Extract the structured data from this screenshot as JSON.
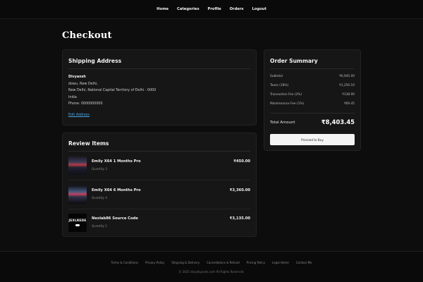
{
  "nav": {
    "items": [
      "Home",
      "Categories",
      "Profile",
      "Orders",
      "Logout"
    ]
  },
  "page": {
    "title": "Checkout"
  },
  "shipping": {
    "title": "Shipping Address",
    "name": "Divyansh",
    "line1": "dowu, New Delhi,",
    "line2": "New Delhi, National Capital Territory of Delhi - 0000",
    "country": "India",
    "phone": "Phone: 0000000000",
    "edit_label": "Edit Address"
  },
  "review": {
    "title": "Review Items",
    "items": [
      {
        "name": "Emily X64 1 Months Pro",
        "qty": "Quantity 3",
        "price": "₹450.00",
        "thumb": "product-image"
      },
      {
        "name": "Emily X64 6 Months Pro",
        "qty": "Quantity 4",
        "price": "₹3,360.00",
        "thumb": "product-image"
      },
      {
        "name": "Nexlab86 Source Code",
        "qty": "Quantity 1",
        "price": "₹3,135.00",
        "thumb": "product-logo",
        "logo_text": "JEXLREDE"
      }
    ]
  },
  "summary": {
    "title": "Order Summary",
    "rows": [
      {
        "label": "Subtotal",
        "value": "₹6,945.00"
      },
      {
        "label": "Taxes (18%)",
        "value": "₹1,250.10"
      },
      {
        "label": "Transaction Fee (2%)",
        "value": "₹138.90"
      },
      {
        "label": "Maintenance Fee (1%)",
        "value": "₹69.45"
      }
    ],
    "total_label": "Total Amount",
    "total_value": "₹8,403.45",
    "buy_label": "Proceed to Buy"
  },
  "footer": {
    "links": [
      "Terms & Conditions",
      "Privacy Policy",
      "Shipping & Delivery",
      "Cancellations & Refund",
      "Pricing Policy",
      "Legal Home",
      "Contact Me"
    ],
    "copyright": "© 2025 divyabyunds.com All Rights Reserved."
  }
}
